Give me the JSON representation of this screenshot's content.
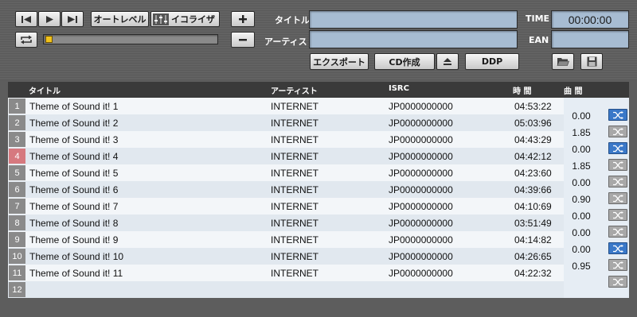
{
  "transport": {
    "prev_icon": "skip-back-icon",
    "play_icon": "play-icon",
    "next_icon": "skip-forward-icon",
    "repeat_icon": "repeat-icon",
    "auto_level_label": "オートレベル",
    "equalizer_label": "イコライザ",
    "add_icon": "plus-icon",
    "remove_icon": "minus-icon"
  },
  "fields": {
    "title_label": "タイトル",
    "artist_label": "アーティスト",
    "time_label": "TIME",
    "time_value": "00:00:00",
    "ean_label": "EAN"
  },
  "actions": {
    "export_label": "エクスポート",
    "cd_label": "CD作成",
    "eject_icon": "eject-icon",
    "ddp_label": "DDP",
    "open_icon": "folder-open-icon",
    "save_icon": "save-icon"
  },
  "table": {
    "headers": {
      "title": "タイトル",
      "artist": "アーティスト",
      "isrc": "ISRC",
      "time": "時 間",
      "gap": "曲 間"
    },
    "rows": [
      {
        "num": "1",
        "title": "Theme of Sound it! 1",
        "artist": "INTERNET",
        "isrc": "JP0000000000",
        "time": "04:53:22"
      },
      {
        "num": "2",
        "title": "Theme of Sound it! 2",
        "artist": "INTERNET",
        "isrc": "JP0000000000",
        "time": "05:03:96"
      },
      {
        "num": "3",
        "title": "Theme of Sound it! 3",
        "artist": "INTERNET",
        "isrc": "JP0000000000",
        "time": "04:43:29"
      },
      {
        "num": "4",
        "title": "Theme of Sound it! 4",
        "artist": "INTERNET",
        "isrc": "JP0000000000",
        "time": "04:42:12"
      },
      {
        "num": "5",
        "title": "Theme of Sound it! 5",
        "artist": "INTERNET",
        "isrc": "JP0000000000",
        "time": "04:23:60"
      },
      {
        "num": "6",
        "title": "Theme of Sound it! 6",
        "artist": "INTERNET",
        "isrc": "JP0000000000",
        "time": "04:39:66"
      },
      {
        "num": "7",
        "title": "Theme of Sound it! 7",
        "artist": "INTERNET",
        "isrc": "JP0000000000",
        "time": "04:10:69"
      },
      {
        "num": "8",
        "title": "Theme of Sound it! 8",
        "artist": "INTERNET",
        "isrc": "JP0000000000",
        "time": "03:51:49"
      },
      {
        "num": "9",
        "title": "Theme of Sound it! 9",
        "artist": "INTERNET",
        "isrc": "JP0000000000",
        "time": "04:14:82"
      },
      {
        "num": "10",
        "title": "Theme of Sound it! 10",
        "artist": "INTERNET",
        "isrc": "JP0000000000",
        "time": "04:26:65"
      },
      {
        "num": "11",
        "title": "Theme of Sound it! 11",
        "artist": "INTERNET",
        "isrc": "JP0000000000",
        "time": "04:22:32"
      },
      {
        "num": "12",
        "title": "",
        "artist": "",
        "isrc": "",
        "time": ""
      }
    ],
    "gaps": [
      "0.00",
      "1.85",
      "0.00",
      "1.85",
      "0.00",
      "0.90",
      "0.00",
      "0.00",
      "0.00",
      "0.95"
    ],
    "crossfade_states": [
      "on",
      "off",
      "on",
      "off",
      "off",
      "off",
      "off",
      "off",
      "on",
      "off",
      "off"
    ],
    "selected_row": "4"
  },
  "colors": {
    "field_blue": "#a7bcd2",
    "crossfade_on": "#3a78c8",
    "crossfade_off": "#a8a8a8",
    "selected_number": "#d6797f",
    "seek_thumb": "#f1c21b"
  },
  "icons": {
    "crossfade": "crossfade-icon"
  }
}
